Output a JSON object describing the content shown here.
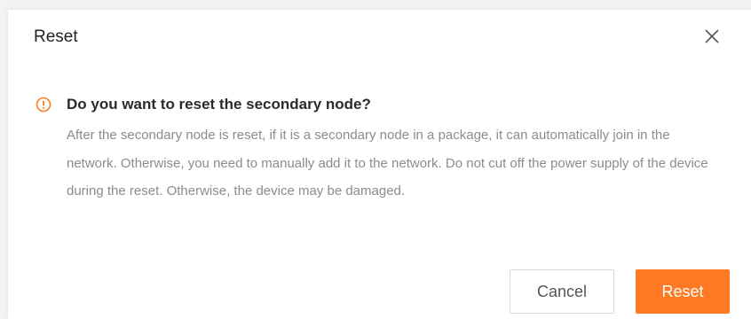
{
  "dialog": {
    "title": "Reset",
    "close_icon": "close-icon",
    "warning_icon": "exclamation-circle-icon",
    "question": "Do you want to reset the secondary node?",
    "message": "After the secondary node is reset, if it is a secondary node in a package, it can automatically join in the network. Otherwise, you need to manually add it to the network. Do not cut off the power supply of the device during the reset. Otherwise, the device may be damaged.",
    "cancel_label": "Cancel",
    "reset_label": "Reset"
  },
  "colors": {
    "accent": "#ff7a22",
    "text_primary": "#222222",
    "text_secondary": "#8c8c8c"
  }
}
